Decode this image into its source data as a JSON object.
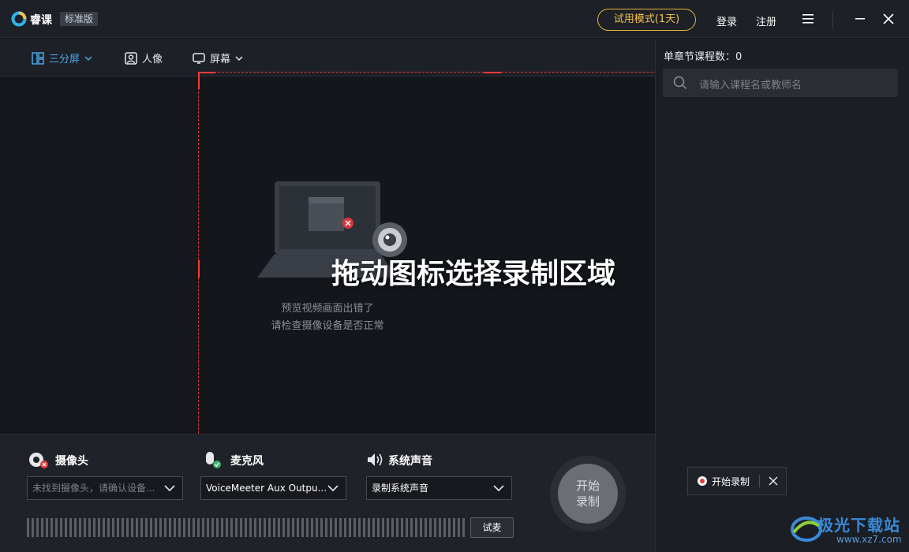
{
  "app": {
    "name": "睿课",
    "edition": "标准版"
  },
  "titlebar": {
    "trial_label": "试用模式(1天)",
    "login_label": "登录",
    "register_label": "注册"
  },
  "toolbar": {
    "layout_label": "三分屏",
    "person_label": "人像",
    "screen_label": "屏幕"
  },
  "preview": {
    "error_line1": "预览视频画面出错了",
    "error_line2": "请检查摄像设备是否正常",
    "drag_hint": "拖动图标选择录制区域"
  },
  "controls": {
    "camera_label": "摄像头",
    "camera_value": "未找到摄像头，请确认设备...",
    "mic_label": "麦克风",
    "mic_value": "VoiceMeeter Aux Outpu...",
    "sysaudio_label": "系统声音",
    "sysaudio_value": "录制系统声音",
    "test_mic_label": "试麦",
    "record_line1": "开始",
    "record_line2": "录制"
  },
  "right_panel": {
    "chapter_count_label": "单章节课程数：",
    "chapter_count_value": "0",
    "search_placeholder": "请输入课程名或教师名"
  },
  "float_bar": {
    "label": "开始录制"
  },
  "watermark": {
    "title": "极光下载站",
    "url": "www.xz7.com"
  },
  "colors": {
    "accent": "#4aa8e8",
    "trial": "#f2c14e",
    "selection": "#e23b3b"
  }
}
